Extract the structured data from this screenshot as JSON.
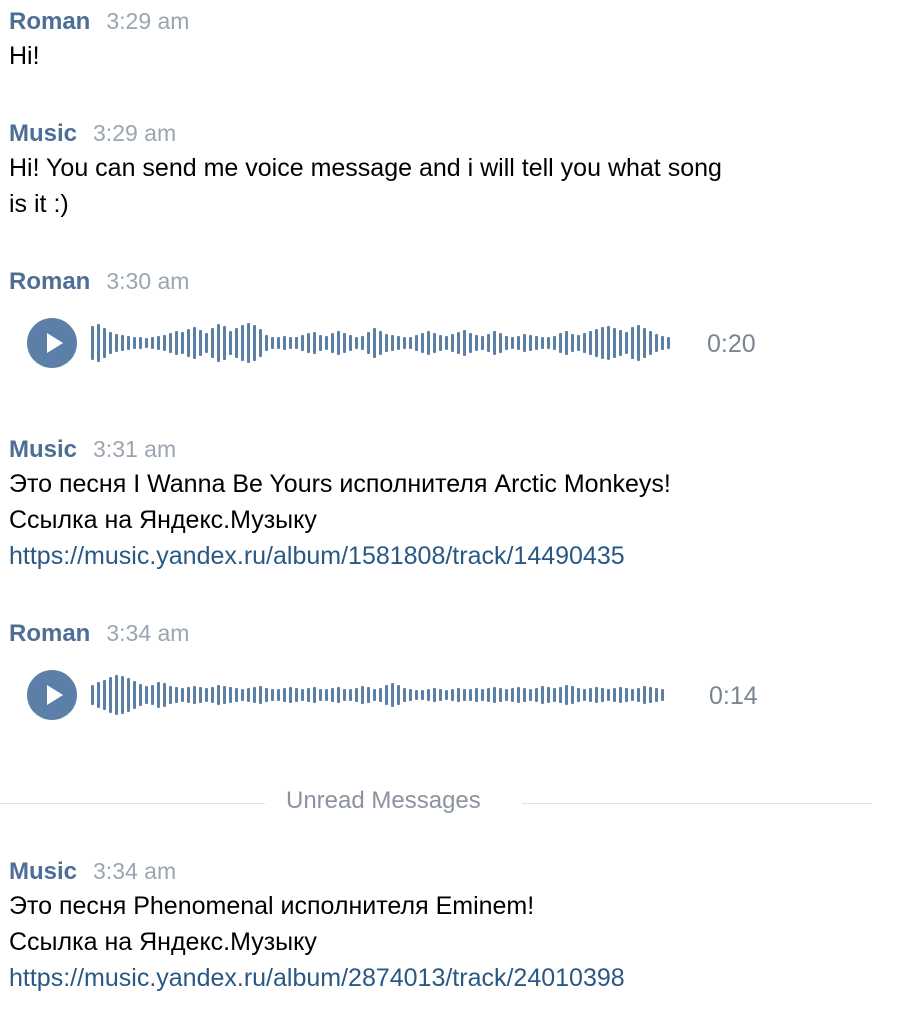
{
  "messages": [
    {
      "sender": "Roman",
      "time": "3:29 am",
      "lines": [
        "Hi!"
      ]
    },
    {
      "sender": "Music",
      "time": "3:29 am",
      "lines": [
        "Hi! You can send me voice message and i will tell you what song",
        "is it :)"
      ]
    },
    {
      "sender": "Roman",
      "time": "3:30 am",
      "voice": {
        "duration": "0:20",
        "play_icon": "play-icon"
      }
    },
    {
      "sender": "Music",
      "time": "3:31 am",
      "lines": [
        "Это песня I Wanna Be Yours исполнителя Arctic Monkeys!",
        "Ссылка на Яндекс.Музыку"
      ],
      "link": "https://music.yandex.ru/album/1581808/track/14490435"
    },
    {
      "sender": "Roman",
      "time": "3:34 am",
      "voice": {
        "duration": "0:14",
        "play_icon": "play-icon"
      }
    },
    {
      "sender": "Music",
      "time": "3:34 am",
      "lines": [
        "Это песня Phenomenal исполнителя Eminem!",
        "Ссылка на Яндекс.Музыку"
      ],
      "link": "https://music.yandex.ru/album/2874013/track/24010398"
    }
  ],
  "divider": {
    "label": "Unread Messages"
  },
  "colors": {
    "sender": "#4e6e96",
    "time": "#9aa5b1",
    "link": "#2a5885",
    "voice_accent": "#5b7fa6"
  }
}
